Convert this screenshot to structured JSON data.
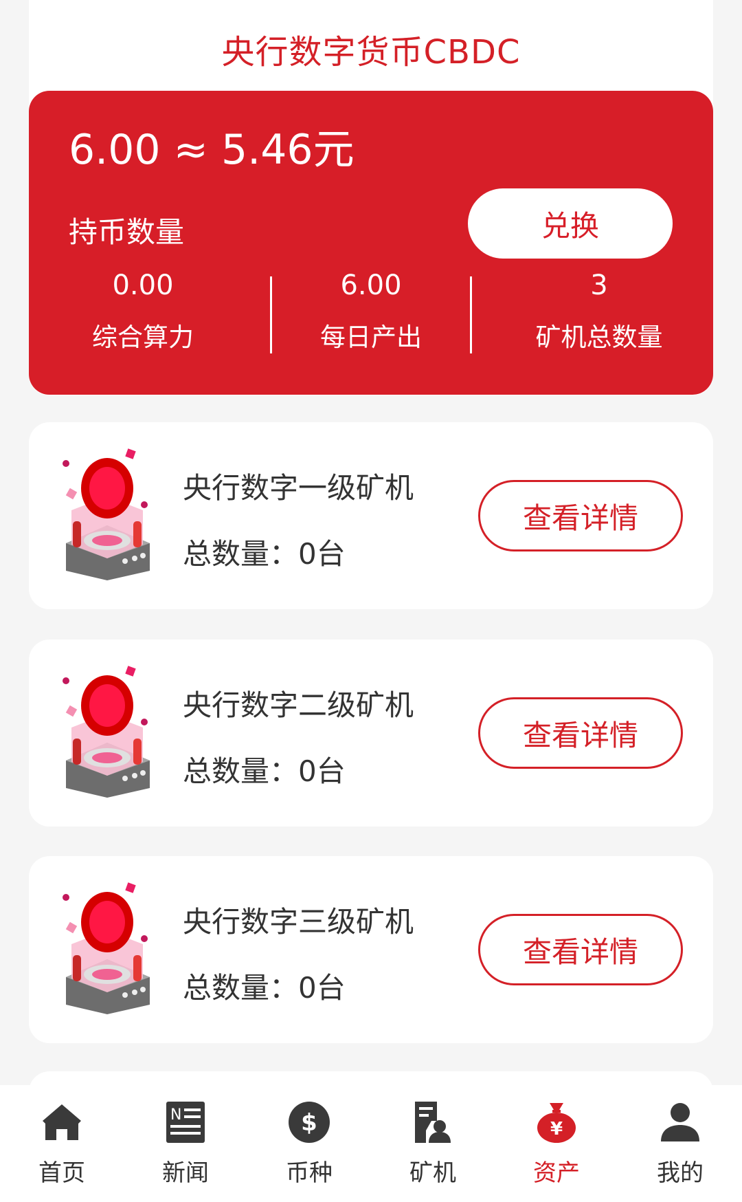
{
  "header": {
    "title": "央行数字货币CBDC"
  },
  "summary": {
    "balance_text": "6.00 ≈ 5.46元",
    "holding_label": "持币数量",
    "exchange_label": "兑换",
    "stats": [
      {
        "value": "0.00",
        "label": "综合算力"
      },
      {
        "value": "6.00",
        "label": "每日产出"
      },
      {
        "value": "3",
        "label": "矿机总数量"
      }
    ]
  },
  "machines": [
    {
      "name": "央行数字一级矿机",
      "count": "总数量：0台",
      "button": "查看详情"
    },
    {
      "name": "央行数字二级矿机",
      "count": "总数量：0台",
      "button": "查看详情"
    },
    {
      "name": "央行数字三级矿机",
      "count": "总数量：0台",
      "button": "查看详情"
    }
  ],
  "nav": [
    {
      "label": "首页",
      "icon": "home-icon"
    },
    {
      "label": "新闻",
      "icon": "news-icon"
    },
    {
      "label": "币种",
      "icon": "dollar-coin-icon"
    },
    {
      "label": "矿机",
      "icon": "miner-icon"
    },
    {
      "label": "资产",
      "icon": "money-bag-icon",
      "active": true
    },
    {
      "label": "我的",
      "icon": "user-icon"
    }
  ],
  "colors": {
    "accent": "#d42027",
    "panel": "#d71e28",
    "background": "#f5f5f5"
  }
}
